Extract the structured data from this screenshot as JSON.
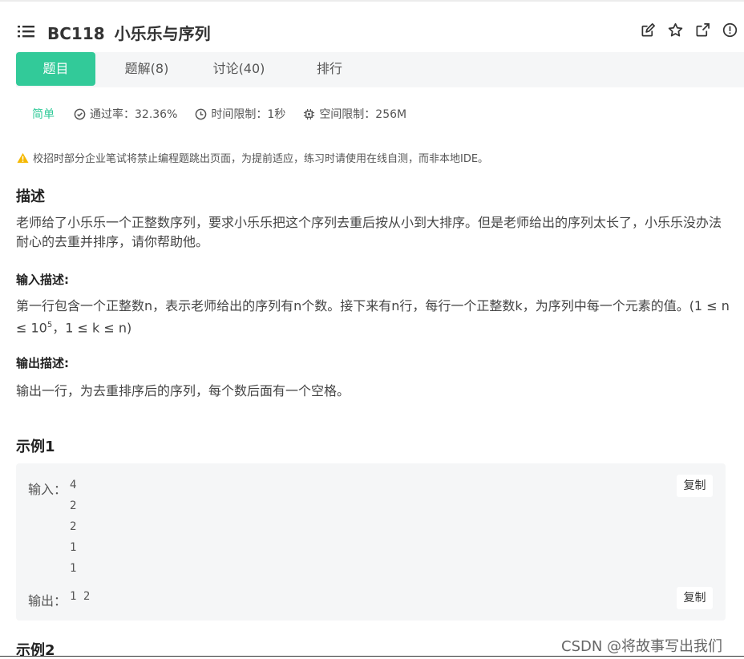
{
  "header": {
    "problem_id": "BC118",
    "problem_name": "小乐乐与序列",
    "icons": [
      "edit-icon",
      "star-icon",
      "external-link-icon",
      "alert-circle-icon"
    ]
  },
  "tabs": [
    {
      "label": "题目",
      "active": true
    },
    {
      "label": "题解(8)",
      "active": false
    },
    {
      "label": "讨论(40)",
      "active": false
    },
    {
      "label": "排行",
      "active": false
    }
  ],
  "meta": {
    "difficulty": "简单",
    "pass_rate": "通过率：32.36%",
    "time_limit": "时间限制：1秒",
    "space_limit": "空间限制：256M"
  },
  "warning": "校招时部分企业笔试将禁止编程题跳出页面，为提前适应，练习时请使用在线自测，而非本地IDE。",
  "description": {
    "heading": "描述",
    "text": "老师给了小乐乐一个正整数序列，要求小乐乐把这个序列去重后按从小到大排序。但是老师给出的序列太长了，小乐乐没办法耐心的去重并排序，请你帮助他。"
  },
  "input_desc": {
    "heading": "输入描述:",
    "text_before": "第一行包含一个正整数n，表示老师给出的序列有n个数。接下来有n行，每行一个正整数k，为序列中每一个元素的值。(1 ≤ n ≤ 10",
    "sup": "5",
    "text_after": "，1 ≤ k ≤ n)"
  },
  "output_desc": {
    "heading": "输出描述:",
    "text": "输出一行，为去重排序后的序列，每个数后面有一个空格。"
  },
  "example1": {
    "heading": "示例1",
    "input_label": "输入：",
    "input_lines": [
      "4",
      "2",
      "2",
      "1",
      "1"
    ],
    "output_label": "输出：",
    "output": "1 2",
    "copy_label": "复制"
  },
  "example2": {
    "heading": "示例2"
  },
  "watermark": "CSDN @将故事写出我们",
  "colors": {
    "accent": "#32ca99",
    "warning": "#f5b800",
    "panel_bg": "#f5f6f7"
  }
}
